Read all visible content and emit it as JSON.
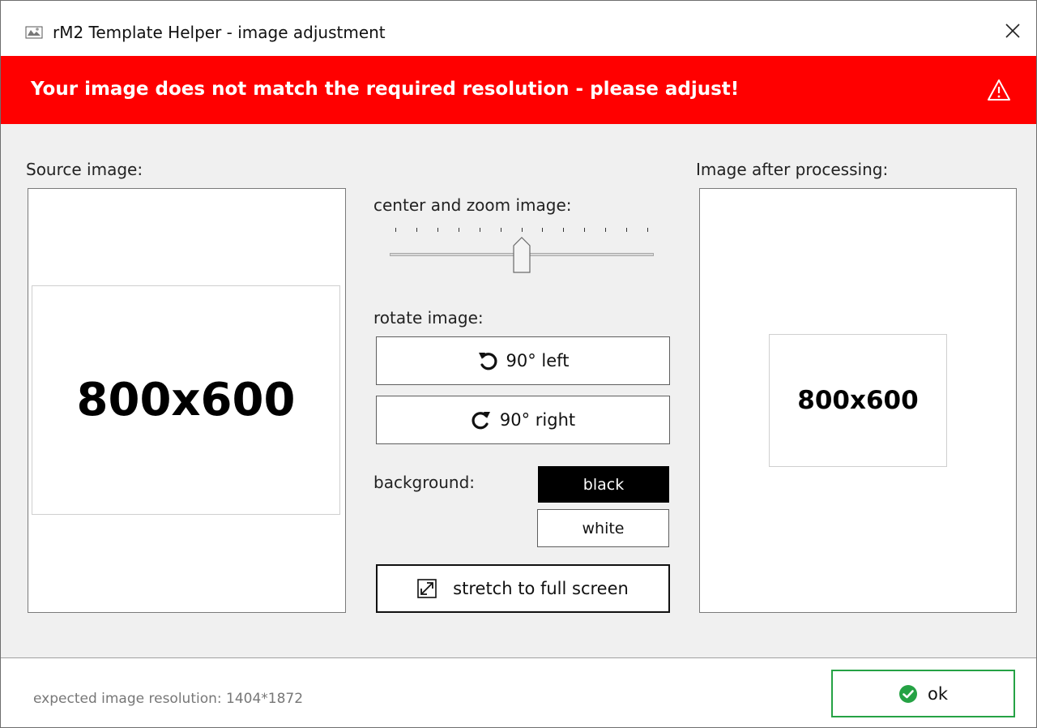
{
  "window": {
    "title": "rM2 Template Helper - image adjustment"
  },
  "banner": {
    "message": "Your image does not match the required resolution - please adjust!",
    "color": "#ff0000"
  },
  "source": {
    "label": "Source image:",
    "image_text": "800x600"
  },
  "processed": {
    "label": "Image after processing:",
    "image_text": "800x600"
  },
  "zoom": {
    "label": "center and zoom image:",
    "tick_count": 13,
    "level": 0.5
  },
  "rotate": {
    "label": "rotate image:",
    "left_label": "90° left",
    "right_label": "90° right"
  },
  "background": {
    "label": "background:",
    "options": [
      "black",
      "white"
    ],
    "selected": "black"
  },
  "stretch": {
    "label": "stretch to full screen"
  },
  "footer": {
    "resolution_text": "expected image resolution: 1404*1872",
    "ok_label": "ok",
    "ok_accent": "#25a244"
  },
  "icons": {
    "app": "rm2-app-icon",
    "close": "close-icon",
    "warning": "warning-icon",
    "rotate_left": "rotate-left-icon",
    "rotate_right": "rotate-right-icon",
    "stretch": "expand-icon",
    "ok": "checkmark-icon"
  }
}
